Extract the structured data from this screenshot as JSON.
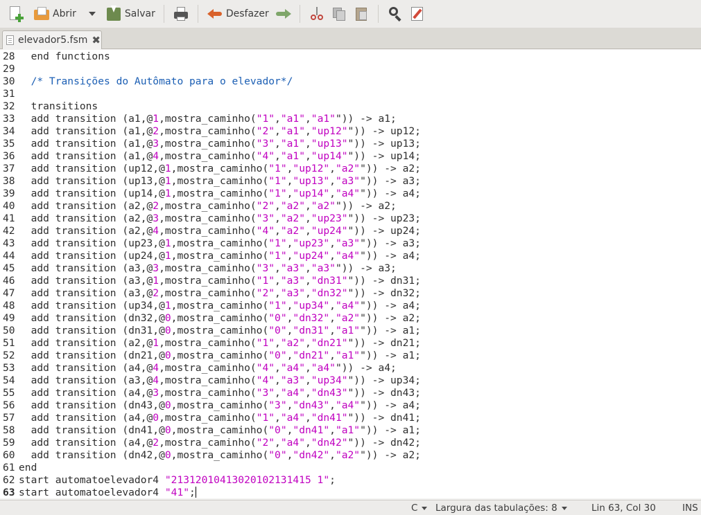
{
  "toolbar": {
    "new_icon": "new-document-icon",
    "open_label": "Abrir",
    "save_label": "Salvar",
    "undo_label": "Desfazer"
  },
  "tab": {
    "title": "elevador5.fsm"
  },
  "editor": {
    "current_line": 63,
    "lines": [
      {
        "n": "28",
        "parts": [
          [
            "",
            "  end functions"
          ]
        ]
      },
      {
        "n": "29",
        "parts": [
          [
            "",
            ""
          ]
        ]
      },
      {
        "n": "30",
        "parts": [
          [
            "c",
            "  /* Transições do Autômato para o elevador*/"
          ]
        ]
      },
      {
        "n": "31",
        "parts": [
          [
            "",
            ""
          ]
        ]
      },
      {
        "n": "32",
        "parts": [
          [
            "",
            "  transitions"
          ]
        ]
      },
      {
        "n": "33",
        "parts": [
          [
            "",
            "  add transition (a1,@"
          ],
          [
            "n",
            "1"
          ],
          [
            "",
            ",mostra_caminho("
          ],
          [
            "s",
            "\"1\""
          ],
          [
            "",
            ","
          ],
          [
            "s",
            "\"a1\""
          ],
          [
            "",
            ","
          ],
          [
            "s",
            "\"a1\""
          ],
          [
            "",
            "\")) -> a1;"
          ]
        ]
      },
      {
        "n": "34",
        "parts": [
          [
            "",
            "  add transition (a1,@"
          ],
          [
            "n",
            "2"
          ],
          [
            "",
            ",mostra_caminho("
          ],
          [
            "s",
            "\"2\""
          ],
          [
            "",
            ","
          ],
          [
            "s",
            "\"a1\""
          ],
          [
            "",
            ","
          ],
          [
            "s",
            "\"up12\""
          ],
          [
            "",
            "\")) -> up12;"
          ]
        ]
      },
      {
        "n": "35",
        "parts": [
          [
            "",
            "  add transition (a1,@"
          ],
          [
            "n",
            "3"
          ],
          [
            "",
            ",mostra_caminho("
          ],
          [
            "s",
            "\"3\""
          ],
          [
            "",
            ","
          ],
          [
            "s",
            "\"a1\""
          ],
          [
            "",
            ","
          ],
          [
            "s",
            "\"up13\""
          ],
          [
            "",
            "\")) -> up13;"
          ]
        ]
      },
      {
        "n": "36",
        "parts": [
          [
            "",
            "  add transition (a1,@"
          ],
          [
            "n",
            "4"
          ],
          [
            "",
            ",mostra_caminho("
          ],
          [
            "s",
            "\"4\""
          ],
          [
            "",
            ","
          ],
          [
            "s",
            "\"a1\""
          ],
          [
            "",
            ","
          ],
          [
            "s",
            "\"up14\""
          ],
          [
            "",
            "\")) -> up14;"
          ]
        ]
      },
      {
        "n": "37",
        "parts": [
          [
            "",
            "  add transition (up12,@"
          ],
          [
            "n",
            "1"
          ],
          [
            "",
            ",mostra_caminho("
          ],
          [
            "s",
            "\"1\""
          ],
          [
            "",
            ","
          ],
          [
            "s",
            "\"up12\""
          ],
          [
            "",
            ","
          ],
          [
            "s",
            "\"a2\""
          ],
          [
            "",
            "\")) -> a2;"
          ]
        ]
      },
      {
        "n": "38",
        "parts": [
          [
            "",
            "  add transition (up13,@"
          ],
          [
            "n",
            "1"
          ],
          [
            "",
            ",mostra_caminho("
          ],
          [
            "s",
            "\"1\""
          ],
          [
            "",
            ","
          ],
          [
            "s",
            "\"up13\""
          ],
          [
            "",
            ","
          ],
          [
            "s",
            "\"a3\""
          ],
          [
            "",
            "\")) -> a3;"
          ]
        ]
      },
      {
        "n": "39",
        "parts": [
          [
            "",
            "  add transition (up14,@"
          ],
          [
            "n",
            "1"
          ],
          [
            "",
            ",mostra_caminho("
          ],
          [
            "s",
            "\"1\""
          ],
          [
            "",
            ","
          ],
          [
            "s",
            "\"up14\""
          ],
          [
            "",
            ","
          ],
          [
            "s",
            "\"a4\""
          ],
          [
            "",
            "\")) -> a4;"
          ]
        ]
      },
      {
        "n": "40",
        "parts": [
          [
            "",
            "  add transition (a2,@"
          ],
          [
            "n",
            "2"
          ],
          [
            "",
            ",mostra_caminho("
          ],
          [
            "s",
            "\"2\""
          ],
          [
            "",
            ","
          ],
          [
            "s",
            "\"a2\""
          ],
          [
            "",
            ","
          ],
          [
            "s",
            "\"a2\""
          ],
          [
            "",
            "\")) -> a2;"
          ]
        ]
      },
      {
        "n": "41",
        "parts": [
          [
            "",
            "  add transition (a2,@"
          ],
          [
            "n",
            "3"
          ],
          [
            "",
            ",mostra_caminho("
          ],
          [
            "s",
            "\"3\""
          ],
          [
            "",
            ","
          ],
          [
            "s",
            "\"a2\""
          ],
          [
            "",
            ","
          ],
          [
            "s",
            "\"up23\""
          ],
          [
            "",
            "\")) -> up23;"
          ]
        ]
      },
      {
        "n": "42",
        "parts": [
          [
            "",
            "  add transition (a2,@"
          ],
          [
            "n",
            "4"
          ],
          [
            "",
            ",mostra_caminho("
          ],
          [
            "s",
            "\"4\""
          ],
          [
            "",
            ","
          ],
          [
            "s",
            "\"a2\""
          ],
          [
            "",
            ","
          ],
          [
            "s",
            "\"up24\""
          ],
          [
            "",
            "\")) -> up24;"
          ]
        ]
      },
      {
        "n": "43",
        "parts": [
          [
            "",
            "  add transition (up23,@"
          ],
          [
            "n",
            "1"
          ],
          [
            "",
            ",mostra_caminho("
          ],
          [
            "s",
            "\"1\""
          ],
          [
            "",
            ","
          ],
          [
            "s",
            "\"up23\""
          ],
          [
            "",
            ","
          ],
          [
            "s",
            "\"a3\""
          ],
          [
            "",
            "\")) -> a3;"
          ]
        ]
      },
      {
        "n": "44",
        "parts": [
          [
            "",
            "  add transition (up24,@"
          ],
          [
            "n",
            "1"
          ],
          [
            "",
            ",mostra_caminho("
          ],
          [
            "s",
            "\"1\""
          ],
          [
            "",
            ","
          ],
          [
            "s",
            "\"up24\""
          ],
          [
            "",
            ","
          ],
          [
            "s",
            "\"a4\""
          ],
          [
            "",
            "\")) -> a4;"
          ]
        ]
      },
      {
        "n": "45",
        "parts": [
          [
            "",
            "  add transition (a3,@"
          ],
          [
            "n",
            "3"
          ],
          [
            "",
            ",mostra_caminho("
          ],
          [
            "s",
            "\"3\""
          ],
          [
            "",
            ","
          ],
          [
            "s",
            "\"a3\""
          ],
          [
            "",
            ","
          ],
          [
            "s",
            "\"a3\""
          ],
          [
            "",
            "\")) -> a3;"
          ]
        ]
      },
      {
        "n": "46",
        "parts": [
          [
            "",
            "  add transition (a3,@"
          ],
          [
            "n",
            "1"
          ],
          [
            "",
            ",mostra_caminho("
          ],
          [
            "s",
            "\"1\""
          ],
          [
            "",
            ","
          ],
          [
            "s",
            "\"a3\""
          ],
          [
            "",
            ","
          ],
          [
            "s",
            "\"dn31\""
          ],
          [
            "",
            "\")) -> dn31;"
          ]
        ]
      },
      {
        "n": "47",
        "parts": [
          [
            "",
            "  add transition (a3,@"
          ],
          [
            "n",
            "2"
          ],
          [
            "",
            ",mostra_caminho("
          ],
          [
            "s",
            "\"2\""
          ],
          [
            "",
            ","
          ],
          [
            "s",
            "\"a3\""
          ],
          [
            "",
            ","
          ],
          [
            "s",
            "\"dn32\""
          ],
          [
            "",
            "\")) -> dn32;"
          ]
        ]
      },
      {
        "n": "48",
        "parts": [
          [
            "",
            "  add transition (up34,@"
          ],
          [
            "n",
            "1"
          ],
          [
            "",
            ",mostra_caminho("
          ],
          [
            "s",
            "\"1\""
          ],
          [
            "",
            ","
          ],
          [
            "s",
            "\"up34\""
          ],
          [
            "",
            ","
          ],
          [
            "s",
            "\"a4\""
          ],
          [
            "",
            "\")) -> a4;"
          ]
        ]
      },
      {
        "n": "49",
        "parts": [
          [
            "",
            "  add transition (dn32,@"
          ],
          [
            "n",
            "0"
          ],
          [
            "",
            ",mostra_caminho("
          ],
          [
            "s",
            "\"0\""
          ],
          [
            "",
            ","
          ],
          [
            "s",
            "\"dn32\""
          ],
          [
            "",
            ","
          ],
          [
            "s",
            "\"a2\""
          ],
          [
            "",
            "\")) -> a2;"
          ]
        ]
      },
      {
        "n": "50",
        "parts": [
          [
            "",
            "  add transition (dn31,@"
          ],
          [
            "n",
            "0"
          ],
          [
            "",
            ",mostra_caminho("
          ],
          [
            "s",
            "\"0\""
          ],
          [
            "",
            ","
          ],
          [
            "s",
            "\"dn31\""
          ],
          [
            "",
            ","
          ],
          [
            "s",
            "\"a1\""
          ],
          [
            "",
            "\")) -> a1;"
          ]
        ]
      },
      {
        "n": "51",
        "parts": [
          [
            "",
            "  add transition (a2,@"
          ],
          [
            "n",
            "1"
          ],
          [
            "",
            ",mostra_caminho("
          ],
          [
            "s",
            "\"1\""
          ],
          [
            "",
            ","
          ],
          [
            "s",
            "\"a2\""
          ],
          [
            "",
            ","
          ],
          [
            "s",
            "\"dn21\""
          ],
          [
            "",
            "\")) -> dn21;"
          ]
        ]
      },
      {
        "n": "52",
        "parts": [
          [
            "",
            "  add transition (dn21,@"
          ],
          [
            "n",
            "0"
          ],
          [
            "",
            ",mostra_caminho("
          ],
          [
            "s",
            "\"0\""
          ],
          [
            "",
            ","
          ],
          [
            "s",
            "\"dn21\""
          ],
          [
            "",
            ","
          ],
          [
            "s",
            "\"a1\""
          ],
          [
            "",
            "\")) -> a1;"
          ]
        ]
      },
      {
        "n": "53",
        "parts": [
          [
            "",
            "  add transition (a4,@"
          ],
          [
            "n",
            "4"
          ],
          [
            "",
            ",mostra_caminho("
          ],
          [
            "s",
            "\"4\""
          ],
          [
            "",
            ","
          ],
          [
            "s",
            "\"a4\""
          ],
          [
            "",
            ","
          ],
          [
            "s",
            "\"a4\""
          ],
          [
            "",
            "\")) -> a4;"
          ]
        ]
      },
      {
        "n": "54",
        "parts": [
          [
            "",
            "  add transition (a3,@"
          ],
          [
            "n",
            "4"
          ],
          [
            "",
            ",mostra_caminho("
          ],
          [
            "s",
            "\"4\""
          ],
          [
            "",
            ","
          ],
          [
            "s",
            "\"a3\""
          ],
          [
            "",
            ","
          ],
          [
            "s",
            "\"up34\""
          ],
          [
            "",
            "\")) -> up34;"
          ]
        ]
      },
      {
        "n": "55",
        "parts": [
          [
            "",
            "  add transition (a4,@"
          ],
          [
            "n",
            "3"
          ],
          [
            "",
            ",mostra_caminho("
          ],
          [
            "s",
            "\"3\""
          ],
          [
            "",
            ","
          ],
          [
            "s",
            "\"a4\""
          ],
          [
            "",
            ","
          ],
          [
            "s",
            "\"dn43\""
          ],
          [
            "",
            "\")) -> dn43;"
          ]
        ]
      },
      {
        "n": "56",
        "parts": [
          [
            "",
            "  add transition (dn43,@"
          ],
          [
            "n",
            "0"
          ],
          [
            "",
            ",mostra_caminho("
          ],
          [
            "s",
            "\"3\""
          ],
          [
            "",
            ","
          ],
          [
            "s",
            "\"dn43\""
          ],
          [
            "",
            ","
          ],
          [
            "s",
            "\"a4\""
          ],
          [
            "",
            "\")) -> a4;"
          ]
        ]
      },
      {
        "n": "57",
        "parts": [
          [
            "",
            "  add transition (a4,@"
          ],
          [
            "n",
            "0"
          ],
          [
            "",
            ",mostra_caminho("
          ],
          [
            "s",
            "\"1\""
          ],
          [
            "",
            ","
          ],
          [
            "s",
            "\"a4\""
          ],
          [
            "",
            ","
          ],
          [
            "s",
            "\"dn41\""
          ],
          [
            "",
            "\")) -> dn41;"
          ]
        ]
      },
      {
        "n": "58",
        "parts": [
          [
            "",
            "  add transition (dn41,@"
          ],
          [
            "n",
            "0"
          ],
          [
            "",
            ",mostra_caminho("
          ],
          [
            "s",
            "\"0\""
          ],
          [
            "",
            ","
          ],
          [
            "s",
            "\"dn41\""
          ],
          [
            "",
            ","
          ],
          [
            "s",
            "\"a1\""
          ],
          [
            "",
            "\")) -> a1;"
          ]
        ]
      },
      {
        "n": "59",
        "parts": [
          [
            "",
            "  add transition (a4,@"
          ],
          [
            "n",
            "2"
          ],
          [
            "",
            ",mostra_caminho("
          ],
          [
            "s",
            "\"2\""
          ],
          [
            "",
            ","
          ],
          [
            "s",
            "\"a4\""
          ],
          [
            "",
            ","
          ],
          [
            "s",
            "\"dn42\""
          ],
          [
            "",
            "\")) -> dn42;"
          ]
        ]
      },
      {
        "n": "60",
        "parts": [
          [
            "",
            "  add transition (dn42,@"
          ],
          [
            "n",
            "0"
          ],
          [
            "",
            ",mostra_caminho("
          ],
          [
            "s",
            "\"0\""
          ],
          [
            "",
            ","
          ],
          [
            "s",
            "\"dn42\""
          ],
          [
            "",
            ","
          ],
          [
            "s",
            "\"a2\""
          ],
          [
            "",
            "\")) -> a2;"
          ]
        ]
      },
      {
        "n": "61",
        "parts": [
          [
            "",
            "end"
          ]
        ]
      },
      {
        "n": "62",
        "parts": [
          [
            "",
            "start automatoelevador4 "
          ],
          [
            "s",
            "\"21312010413020102131415 1\""
          ],
          [
            "",
            ";"
          ]
        ]
      },
      {
        "n": "63",
        "parts": [
          [
            "",
            "start automatoelevador4 "
          ],
          [
            "s",
            "\"41\""
          ],
          [
            "",
            ";"
          ]
        ]
      }
    ]
  },
  "statusbar": {
    "language": "C",
    "tab_width": "Largura das tabulações: 8",
    "position": "Lin 63, Col 30",
    "mode": "INS"
  }
}
